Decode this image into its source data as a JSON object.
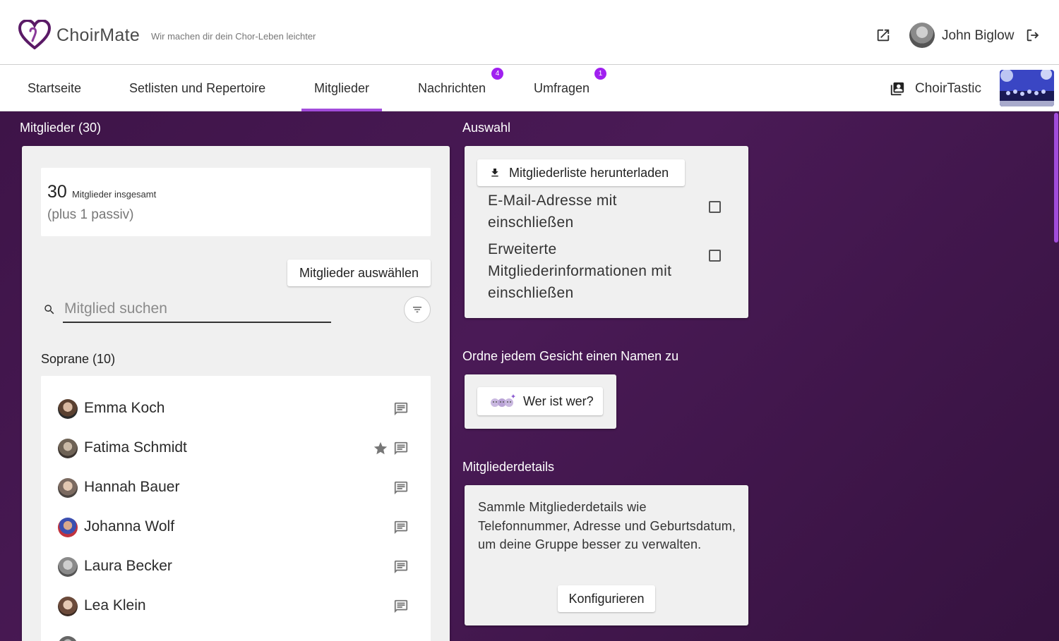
{
  "header": {
    "logo_text": "ChoirMate",
    "tagline": "Wir machen dir dein Chor-Leben leichter",
    "user_name": "John Biglow"
  },
  "nav": {
    "tabs": [
      {
        "label": "Startseite"
      },
      {
        "label": "Setlisten und Repertoire"
      },
      {
        "label": "Mitglieder",
        "active": true
      },
      {
        "label": "Nachrichten",
        "badge": "4"
      },
      {
        "label": "Umfragen",
        "badge": "1"
      }
    ],
    "choir_name": "ChoirTastic"
  },
  "members_panel": {
    "title": "Mitglieder (30)",
    "total_count": "30",
    "total_label": "Mitglieder insgesamt",
    "passive_note": "(plus 1 passiv)",
    "select_button": "Mitglieder auswählen",
    "search_placeholder": "Mitglied suchen",
    "group_title": "Soprane (10)",
    "members": [
      {
        "name": "Emma Koch"
      },
      {
        "name": "Fatima Schmidt",
        "starred": true
      },
      {
        "name": "Hannah Bauer"
      },
      {
        "name": "Johanna Wolf"
      },
      {
        "name": "Laura Becker"
      },
      {
        "name": "Lea Klein"
      }
    ]
  },
  "selection": {
    "title": "Auswahl",
    "download_button": "Mitgliederliste herunterladen",
    "option_email_line1": "E-Mail-Adresse mit",
    "option_email_line2": "einschließen",
    "option_extended_line1": "Erweiterte",
    "option_extended_line2": "Mitgliederinformationen mit",
    "option_extended_line3": "einschließen"
  },
  "faces": {
    "title": "Ordne jedem Gesicht einen Namen zu",
    "button": "Wer ist wer?"
  },
  "details": {
    "title": "Mitgliederdetails",
    "text": "Sammle Mitgliederdetails wie Telefonnummer, Adresse und Geburtsdatum, um deine Gruppe besser zu verwalten.",
    "button": "Konfigurieren"
  },
  "colors": {
    "accent": "#a24cdb",
    "badge": "#a020f0",
    "background": "#3e1448"
  }
}
